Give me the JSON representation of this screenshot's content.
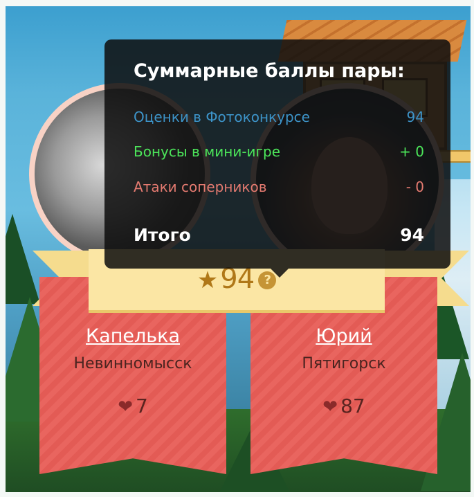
{
  "tooltip": {
    "title": "Суммарные баллы пары:",
    "rows": [
      {
        "label": "Оценки в Фотоконкурсе",
        "value": "94",
        "color": "#3d94c9"
      },
      {
        "label": "Бонусы в мини-игре",
        "value": "+ 0",
        "color": "#4ce65a"
      },
      {
        "label": "Атаки соперников",
        "value": "- 0",
        "color": "#e47a70"
      }
    ],
    "total_label": "Итого",
    "total_value": "94"
  },
  "pair_score": {
    "value": "94",
    "help_icon": "?"
  },
  "players": [
    {
      "name": "Капелька",
      "city": "Невинномысск",
      "likes": "7"
    },
    {
      "name": "Юрий",
      "city": "Пятигорск",
      "likes": "87"
    }
  ],
  "colors": {
    "card": "#e9655f",
    "ribbon": "#fbe6a4",
    "score": "#b07818"
  }
}
